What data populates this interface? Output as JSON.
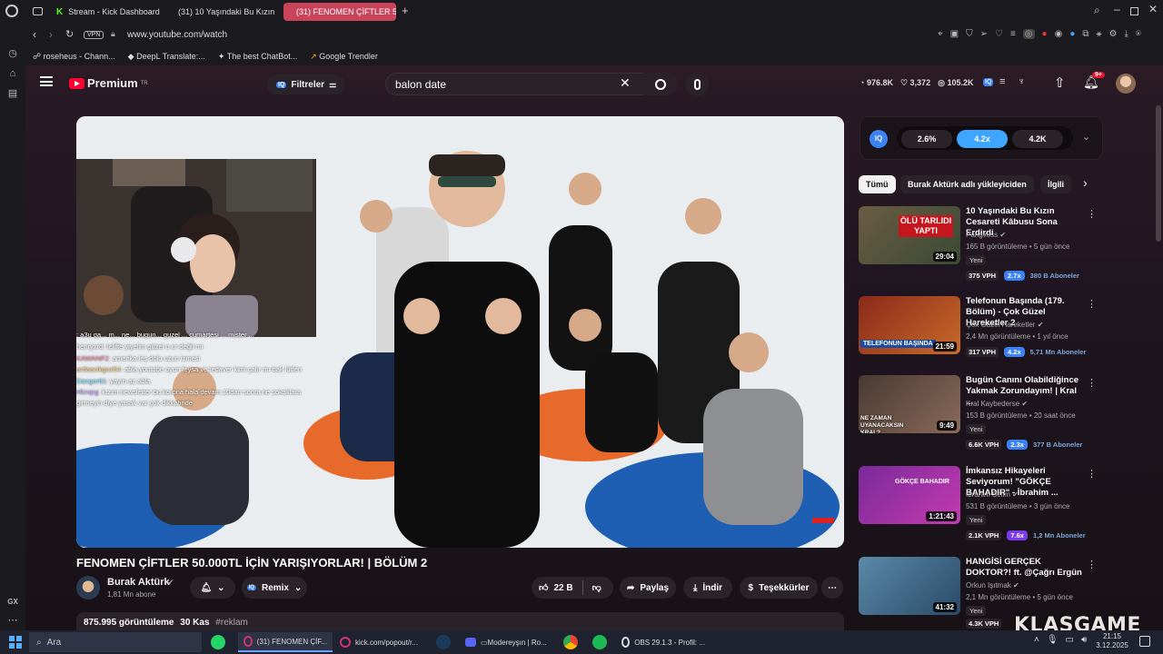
{
  "tabs": [
    {
      "label": "Stream - Kick Dashboard",
      "icon": "kick-icon"
    },
    {
      "label": "(31) 10 Yaşındaki Bu Kızın",
      "icon": "youtube-icon"
    },
    {
      "label": "(31) FENOMEN ÇİFTLER 5",
      "icon": "youtube-icon",
      "active": true
    }
  ],
  "address": {
    "vpn": "VPN",
    "url": "www.youtube.com/watch"
  },
  "bookmarks": [
    "roseheus - Chann...",
    "DeepL Translate:...",
    "The best ChatBot...",
    "Google Trendler"
  ],
  "leftrail": {
    "bottom_label": "GX"
  },
  "header": {
    "logo": "Premium",
    "logo_region": "TR",
    "filters_label": "Filtreler",
    "search_value": "balon date",
    "stats": {
      "views": "976.8K",
      "likes": "3,372",
      "subs": "105.2K"
    },
    "notif_count": "9+",
    "iq_badge": "IQ"
  },
  "webcam_chat": [
    {
      "user": "",
      "text": ": a3u qa... m... ne... bugun... guzel ... cumartesi ... mister ..."
    },
    {
      "user": "henryxrd",
      "text": ": telifte yiyelim güzel o ur değil mi"
    },
    {
      "user": "KAWANF2",
      "text": ": amerika leş dolu uzun izmesi"
    },
    {
      "user": "ardaacikgoz54",
      "text": ": abla youtube oyun feysa ve tedaver kimi çalır mı bak lütfen"
    },
    {
      "user": "Danger61",
      "text": ": yayın az abla"
    },
    {
      "user": "Hknqrg",
      "text": ": kızım newsletter bu korona hala devam 10dan sonra ne sokaklara girmeyin diye yasak var çok dikkatinde"
    }
  ],
  "video": {
    "title": "FENOMEN ÇİFTLER 50.000TL İÇİN YARIŞIYORLAR! | BÖLÜM 2",
    "channel": "Burak Aktürk",
    "subscribers": "1,81 Mn abone",
    "remix_label": "Remix",
    "likes": "22 B",
    "share_label": "Paylaş",
    "download_label": "İndir",
    "thanks_label": "Teşekkürler",
    "views": "875.995 görüntüleme",
    "date": "30 Kas",
    "hashtag": "#reklam",
    "iq_label": "IQ"
  },
  "iq_panel": {
    "iq": "IQ",
    "pills": [
      "2.6%",
      "4.2x",
      "4.2K"
    ]
  },
  "chips": [
    "Tümü",
    "Burak Aktürk adlı yükleyiciden",
    "İlgili"
  ],
  "recommendations": [
    {
      "title": "10 Yaşındaki Bu Kızın Cesareti Kâbusu Sona Erdirdi",
      "channel": "Pangvoss",
      "meta": "165 B görüntüleme • 5 gün önce",
      "badge": "Yeni",
      "duration": "29:04",
      "vph": "375 VPH",
      "mult": "2.7x",
      "mult_color": "#3b82f6",
      "subs": "380 B Aboneler",
      "thumb_text": "ÖLÜ TARLIDI YAPTI"
    },
    {
      "title": "Telefonun Başında (179. Bölüm) - Çok Güzel Hareketler 2",
      "channel": "Çok Güzel Hareketler",
      "meta": "2,4 Mn görüntüleme • 1 yıl önce",
      "badge": "",
      "duration": "21:59",
      "vph": "317 VPH",
      "mult": "4.2x",
      "mult_color": "#3b82f6",
      "subs": "5,71 Mn Aboneler",
      "thumb_text": "TELEFONUN BAŞINDA"
    },
    {
      "title": "Bugün Canını Olabildiğince Yakmak Zorundayım! | Kral ...",
      "channel": "Kral Kaybederse",
      "meta": "153 B görüntüleme • 20 saat önce",
      "badge": "Yeni",
      "duration": "9:49",
      "vph": "6.6K VPH",
      "mult": "2.3x",
      "mult_color": "#3b82f6",
      "subs": "377 B Aboneler",
      "thumb_text": "NE ZAMAN UYANACAKSIN KRAL?"
    },
    {
      "title": "İmkansız Hikayeleri Seviyorum! \"GÖKÇE BAHADIR\" - İbrahim ...",
      "channel": "İbrahim Selim",
      "meta": "531 B görüntüleme • 3 gün önce",
      "badge": "Yeni",
      "duration": "1:21:43",
      "vph": "2.1K VPH",
      "mult": "7.6x",
      "mult_color": "#7c3aed",
      "subs": "1,2 Mn Aboneler",
      "thumb_text": "GÖKÇE BAHADIR"
    },
    {
      "title": "HANGİSİ GERÇEK DOKTOR?! ft. @Çağrı Ergün",
      "channel": "Orkun Işıtmak",
      "meta": "2,1 Mn görüntüleme • 5 gün önce",
      "badge": "Yeni",
      "duration": "41:32",
      "vph": "4.3K VPH",
      "mult": "",
      "mult_color": "#3b82f6",
      "subs": "",
      "thumb_text": ""
    }
  ],
  "taskbar": {
    "search": "Ara",
    "apps": [
      {
        "label": "(31) FENOMEN ÇİF...",
        "icon": "opera-gx-icon",
        "on": true
      },
      {
        "label": "kick.com/popout/r...",
        "icon": "opera-gx-icon",
        "on": false
      },
      {
        "label": "",
        "icon": "steam-icon",
        "on": false
      },
      {
        "label": "▭Modereyşın | Ro...",
        "icon": "discord-icon",
        "on": false
      },
      {
        "label": "",
        "icon": "chrome-icon",
        "on": false
      },
      {
        "label": "",
        "icon": "spotify-icon",
        "on": false
      },
      {
        "label": "OBS 29.1.3 - Profil: ...",
        "icon": "obs-icon",
        "on": false
      }
    ],
    "time": "21:15",
    "date": "3.12.2025"
  },
  "watermark": "KLASGAME",
  "colors": {
    "accent": "#3ea6ff",
    "yt_red": "#ff0033",
    "tab_active": "#c9435a"
  }
}
